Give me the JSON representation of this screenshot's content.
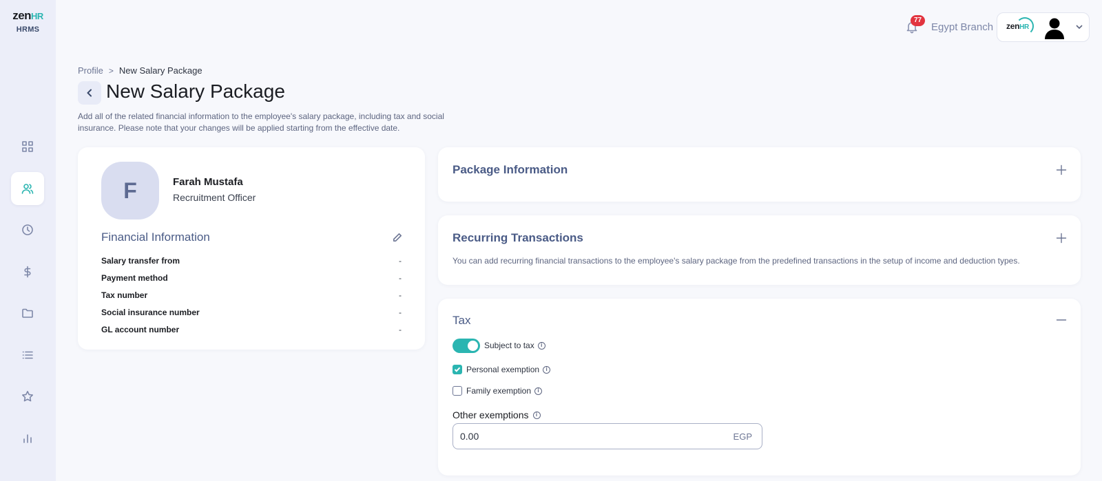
{
  "brand": {
    "name": "zen",
    "name_hr": "HR",
    "subtitle": "HRMS"
  },
  "sidebar": {
    "items": [
      {
        "name": "dashboard",
        "icon": "grid-icon",
        "active": false
      },
      {
        "name": "people",
        "icon": "users-icon",
        "active": true
      },
      {
        "name": "time",
        "icon": "clock-icon",
        "active": false
      },
      {
        "name": "payroll",
        "icon": "dollar-icon",
        "active": false
      },
      {
        "name": "documents",
        "icon": "folder-icon",
        "active": false
      },
      {
        "name": "lists",
        "icon": "list-icon",
        "active": false
      },
      {
        "name": "favorites",
        "icon": "star-icon",
        "active": false
      },
      {
        "name": "reports",
        "icon": "bar-chart-icon",
        "active": false
      }
    ]
  },
  "header": {
    "notifications_count": "77",
    "branch": "Egypt Branch",
    "account_logo": "zen",
    "account_logo_hr": "HR"
  },
  "breadcrumb": {
    "parent": "Profile",
    "separator": ">",
    "current": "New Salary Package"
  },
  "page": {
    "title": "New Salary Package",
    "description": "Add all of the related financial information to the employee's salary package, including tax and social insurance. Please note that your changes will be applied starting from the effective date."
  },
  "employee": {
    "initial": "F",
    "name": "Farah Mustafa",
    "role": "Recruitment Officer"
  },
  "financial": {
    "title": "Financial Information",
    "rows": [
      {
        "label": "Salary transfer from",
        "value": "-"
      },
      {
        "label": "Payment method",
        "value": "-"
      },
      {
        "label": "Tax number",
        "value": "-"
      },
      {
        "label": "Social insurance number",
        "value": "-"
      },
      {
        "label": "GL account number",
        "value": "-"
      }
    ]
  },
  "package_info": {
    "title": "Package Information"
  },
  "recurring": {
    "title": "Recurring Transactions",
    "description": "You can add recurring financial transactions to the employee's salary package from the predefined transactions in the setup of income and deduction types."
  },
  "tax": {
    "title": "Tax",
    "subject_to_tax_label": "Subject to tax",
    "subject_to_tax": true,
    "personal_exemption_label": "Personal exemption",
    "personal_exemption": true,
    "family_exemption_label": "Family exemption",
    "family_exemption": false,
    "other_exemptions_label": "Other exemptions",
    "other_exemptions_value": "0.00",
    "currency": "EGP"
  },
  "colors": {
    "accent": "#2bb5b1",
    "sidebar_bg": "#eceef9",
    "section_title": "#4a5b86",
    "badge": "#e2343f"
  }
}
